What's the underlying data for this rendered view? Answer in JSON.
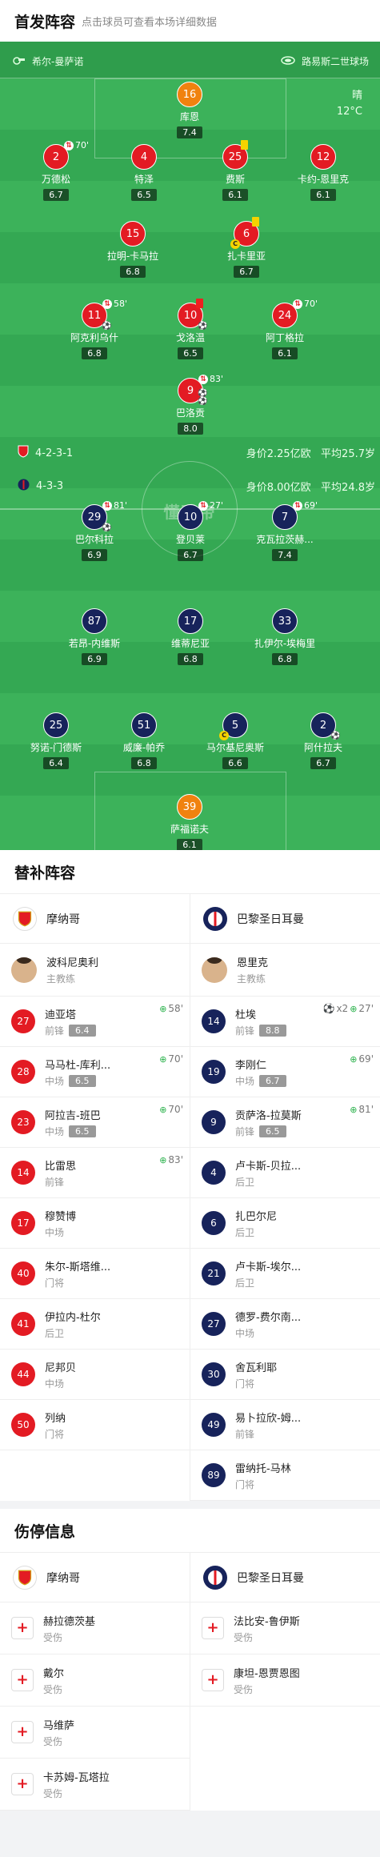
{
  "header": {
    "title": "首发阵容",
    "subtitle": "点击球员可查看本场详细数据"
  },
  "venue": {
    "referee": "希尔-曼萨诺",
    "stadium": "路易斯二世球场"
  },
  "weather": {
    "condition": "晴",
    "temp": "12°C"
  },
  "watermark": "懂球帝",
  "home_formation": {
    "formation": "4-2-3-1",
    "value": "身价2.25亿欧",
    "age": "平均25.7岁"
  },
  "away_formation": {
    "formation": "4-3-3",
    "value": "身价8.00亿欧",
    "age": "平均24.8岁"
  },
  "home_players": [
    {
      "num": "16",
      "name": "库恩",
      "rating": "7.4",
      "gk": true
    },
    {
      "num": "2",
      "name": "万德松",
      "rating": "6.7",
      "sub": "70'"
    },
    {
      "num": "4",
      "name": "特泽",
      "rating": "6.5"
    },
    {
      "num": "25",
      "name": "费斯",
      "rating": "6.1",
      "card": "yellow"
    },
    {
      "num": "12",
      "name": "卡约-恩里克",
      "rating": "6.1"
    },
    {
      "num": "15",
      "name": "拉明-卡马拉",
      "rating": "6.8"
    },
    {
      "num": "6",
      "name": "扎卡里亚",
      "rating": "6.7",
      "card": "yellow",
      "captain": "C"
    },
    {
      "num": "11",
      "name": "阿克利乌什",
      "rating": "6.8",
      "sub": "58'"
    },
    {
      "num": "10",
      "name": "戈洛温",
      "rating": "6.5",
      "card": "red"
    },
    {
      "num": "24",
      "name": "阿丁格拉",
      "rating": "6.1",
      "sub": "70'"
    },
    {
      "num": "9",
      "name": "巴洛贡",
      "rating": "8.0",
      "sub": "83'"
    }
  ],
  "away_players": [
    {
      "num": "29",
      "name": "巴尔科拉",
      "rating": "6.9",
      "sub": "81'"
    },
    {
      "num": "10",
      "name": "登贝莱",
      "rating": "6.7",
      "sub": "27'"
    },
    {
      "num": "7",
      "name": "克瓦拉茨赫...",
      "rating": "7.4",
      "sub": "69'"
    },
    {
      "num": "87",
      "name": "若昂-内维斯",
      "rating": "6.9"
    },
    {
      "num": "17",
      "name": "维蒂尼亚",
      "rating": "6.8"
    },
    {
      "num": "33",
      "name": "扎伊尔-埃梅里",
      "rating": "6.8"
    },
    {
      "num": "25",
      "name": "努诺-门德斯",
      "rating": "6.4"
    },
    {
      "num": "51",
      "name": "威廉-帕乔",
      "rating": "6.8"
    },
    {
      "num": "5",
      "name": "马尔基尼奥斯",
      "rating": "6.6",
      "captain": "C"
    },
    {
      "num": "2",
      "name": "阿什拉夫",
      "rating": "6.7"
    },
    {
      "num": "39",
      "name": "萨福诺夫",
      "rating": "6.1",
      "gk": true
    }
  ],
  "subs": {
    "title": "替补阵容",
    "home_team": "摩纳哥",
    "away_team": "巴黎圣日耳曼",
    "home_coach": {
      "name": "波科尼奥利",
      "role": "主教练"
    },
    "away_coach": {
      "name": "恩里克",
      "role": "主教练"
    },
    "home": [
      {
        "num": "27",
        "name": "迪亚塔",
        "pos": "前锋",
        "rating": "6.4",
        "event": "58'"
      },
      {
        "num": "28",
        "name": "马马杜-库利...",
        "pos": "中场",
        "rating": "6.5",
        "event": "70'"
      },
      {
        "num": "23",
        "name": "阿拉吉-班巴",
        "pos": "中场",
        "rating": "6.5",
        "event": "70'"
      },
      {
        "num": "14",
        "name": "比雷思",
        "pos": "前锋",
        "rating": "",
        "event": "83'"
      },
      {
        "num": "17",
        "name": "穆赞博",
        "pos": "中场",
        "rating": "",
        "event": ""
      },
      {
        "num": "40",
        "name": "朱尔-斯塔维...",
        "pos": "门将",
        "rating": "",
        "event": ""
      },
      {
        "num": "41",
        "name": "伊拉内-杜尔",
        "pos": "后卫",
        "rating": "",
        "event": ""
      },
      {
        "num": "44",
        "name": "尼邦贝",
        "pos": "中场",
        "rating": "",
        "event": ""
      },
      {
        "num": "50",
        "name": "列纳",
        "pos": "门将",
        "rating": "",
        "event": ""
      }
    ],
    "away": [
      {
        "num": "14",
        "name": "杜埃",
        "pos": "前锋",
        "rating": "8.8",
        "event": "27'",
        "goals": "x2"
      },
      {
        "num": "19",
        "name": "李刚仁",
        "pos": "中场",
        "rating": "6.7",
        "event": "69'"
      },
      {
        "num": "9",
        "name": "贡萨洛-拉莫斯",
        "pos": "前锋",
        "rating": "6.5",
        "event": "81'"
      },
      {
        "num": "4",
        "name": "卢卡斯-贝拉...",
        "pos": "后卫",
        "rating": "",
        "event": ""
      },
      {
        "num": "6",
        "name": "扎巴尔尼",
        "pos": "后卫",
        "rating": "",
        "event": ""
      },
      {
        "num": "21",
        "name": "卢卡斯-埃尔...",
        "pos": "后卫",
        "rating": "",
        "event": ""
      },
      {
        "num": "27",
        "name": "德罗-费尔南...",
        "pos": "中场",
        "rating": "",
        "event": ""
      },
      {
        "num": "30",
        "name": "舍瓦利耶",
        "pos": "门将",
        "rating": "",
        "event": ""
      },
      {
        "num": "49",
        "name": "易卜拉欣-姆...",
        "pos": "前锋",
        "rating": "",
        "event": ""
      },
      {
        "num": "89",
        "name": "雷纳托-马林",
        "pos": "门将",
        "rating": "",
        "event": ""
      }
    ]
  },
  "injuries": {
    "title": "伤停信息",
    "home_team": "摩纳哥",
    "away_team": "巴黎圣日耳曼",
    "home": [
      {
        "name": "赫拉德茨基",
        "status": "受伤"
      },
      {
        "name": "戴尔",
        "status": "受伤"
      },
      {
        "name": "马维萨",
        "status": "受伤"
      },
      {
        "name": "卡苏姆-瓦塔拉",
        "status": "受伤"
      }
    ],
    "away": [
      {
        "name": "法比安-鲁伊斯",
        "status": "受伤"
      },
      {
        "name": "康坦-恩贾恩图",
        "status": "受伤"
      }
    ]
  },
  "colors": {
    "pitch": "#34a853",
    "home": "#e31b23",
    "away": "#17235b",
    "gk": "#f0820f"
  }
}
